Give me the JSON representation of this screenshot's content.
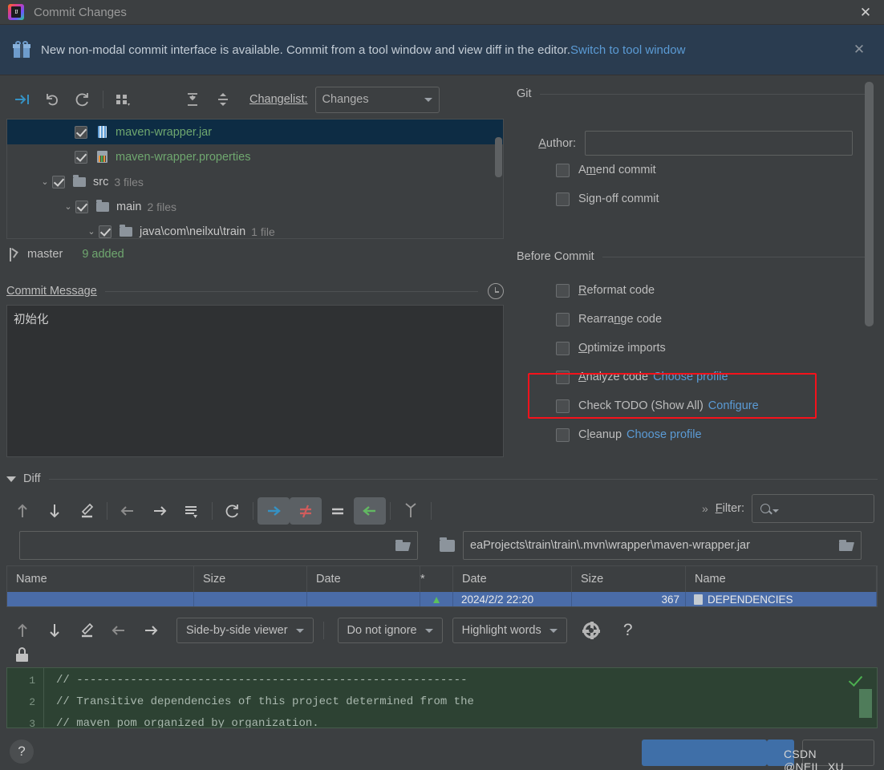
{
  "window": {
    "title": "Commit Changes",
    "close_label": "✕",
    "logo_text": "IJ"
  },
  "banner": {
    "icon": "gift-icon",
    "text": "New non-modal commit interface is available. Commit from a tool window and view diff in the editor.",
    "link": "Switch to tool window",
    "close_label": "✕"
  },
  "changes_toolbar": {
    "icons": [
      "show-diff-icon",
      "rollback-icon",
      "refresh-icon",
      "group-by-icon",
      "expand-all-icon",
      "collapse-all-icon"
    ],
    "changelist_label": "Changelist:",
    "changelist_value": "Changes"
  },
  "file_tree": {
    "rows": [
      {
        "indent": 2,
        "chevron": "",
        "checked": true,
        "icon": "jar-file-icon",
        "name": "maven-wrapper.jar",
        "meta": "",
        "selected": true,
        "color": "added"
      },
      {
        "indent": 2,
        "chevron": "",
        "checked": true,
        "icon": "properties-file-icon",
        "name": "maven-wrapper.properties",
        "meta": "",
        "selected": false,
        "color": "added"
      },
      {
        "indent": 0,
        "chevron": "⌄",
        "checked": true,
        "icon": "folder-icon",
        "name": "src",
        "meta": "3 files",
        "selected": false,
        "color": "plain"
      },
      {
        "indent": 1,
        "chevron": "⌄",
        "checked": true,
        "icon": "folder-icon",
        "name": "main",
        "meta": "2 files",
        "selected": false,
        "color": "plain"
      },
      {
        "indent": 2,
        "chevron": "⌄",
        "checked": true,
        "icon": "folder-icon",
        "name": "java\\com\\neilxu\\train",
        "meta": "1 file",
        "selected": false,
        "color": "plain"
      }
    ]
  },
  "branch_bar": {
    "branch": "master",
    "stats": "9 added"
  },
  "commit_message": {
    "label": "Commit Message",
    "history_icon": "clock-icon",
    "value": "初始化"
  },
  "git_section": {
    "title": "Git",
    "author_label": "Author:",
    "author_value": "",
    "checkboxes": [
      {
        "label": "Amend commit",
        "checked": false
      },
      {
        "label": "Sign-off commit",
        "checked": false
      }
    ]
  },
  "before_commit": {
    "title": "Before Commit",
    "items": [
      {
        "label": "Reformat code",
        "checked": false,
        "link": ""
      },
      {
        "label": "Rearrange code",
        "checked": false,
        "link": ""
      },
      {
        "label": "Optimize imports",
        "checked": false,
        "link": ""
      },
      {
        "label": "Analyze code",
        "checked": false,
        "link": "Choose profile"
      },
      {
        "label": "Check TODO (Show All)",
        "checked": false,
        "link": "Configure"
      },
      {
        "label": "Cleanup",
        "checked": false,
        "link": "Choose profile"
      }
    ],
    "highlight_color": "#f5121b"
  },
  "diff": {
    "title": "Diff",
    "toolbar_icons": [
      "previous-difference-icon",
      "next-difference-icon",
      "edit-icon",
      "left-arrow-icon",
      "right-arrow-icon",
      "line-options-icon",
      "refresh-icon",
      "accept-right-icon",
      "not-equal-icon",
      "equal-icon",
      "accept-left-icon",
      "merge-icon"
    ],
    "filter_chevron": "»",
    "filter_label": "Filter:",
    "filter_placeholder": "",
    "left_path": "",
    "right_path": "еaProjects\\train\\train\\.mvn\\wrapper\\maven-wrapper.jar",
    "table": {
      "columns": [
        "Name",
        "Size",
        "Date",
        "*",
        "Date",
        "Size",
        "Name"
      ],
      "rows": [
        {
          "name_left": "",
          "size_left": "",
          "date_left": "",
          "star": "▲",
          "date_right": "2024/2/2 22:20",
          "size_right": "367",
          "name_right": "DEPENDENCIES"
        }
      ]
    },
    "viewer_combo": "Side-by-side viewer",
    "ignore_combo": "Do not ignore",
    "highlight_combo": "Highlight words",
    "settings_icon": "gear-icon",
    "help_icon": "?"
  },
  "editor": {
    "lock_icon": "lock-icon",
    "lines": [
      {
        "number": "1",
        "text": "// ----------------------------------------------------------"
      },
      {
        "number": "2",
        "text": "// Transitive dependencies of this project determined from the"
      },
      {
        "number": "3",
        "text": "// maven pom organized by organization."
      }
    ],
    "status_icon": "green-check-icon"
  },
  "bottom": {
    "help_label": "?",
    "commit_label": "",
    "cancel_label": ""
  },
  "watermark": "CSDN @NEIL_XU_"
}
